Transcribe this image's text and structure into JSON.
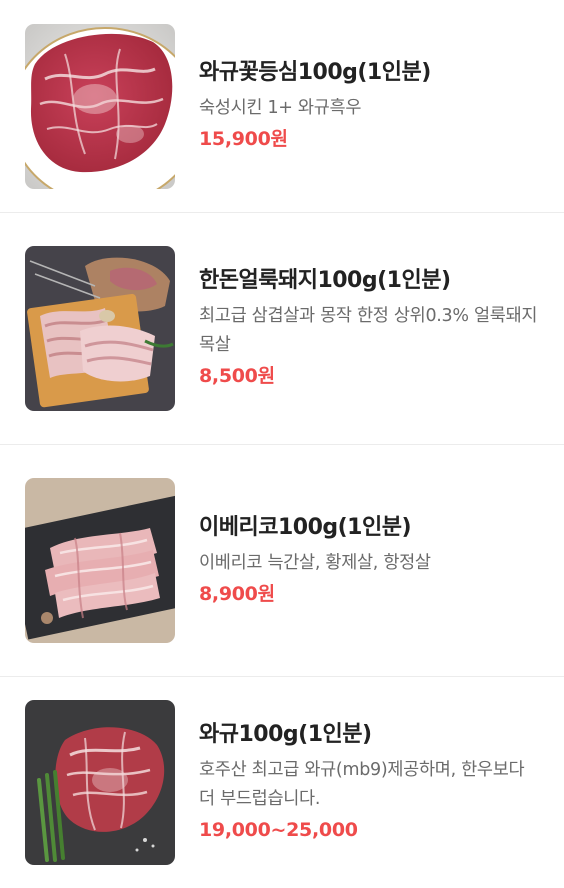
{
  "menu": {
    "items": [
      {
        "name": "와규꽃등심100g(1인분)",
        "description": "숙성시킨 1+ 와규흑우",
        "price": "15,900원",
        "image": "wagyu-ribeye-steak-photo"
      },
      {
        "name": "한돈얼룩돼지100g(1인분)",
        "description": "최고급 삼겹살과 몽작 한정 상위0.3% 얼룩돼지 목살",
        "price": "8,500원",
        "image": "pork-belly-on-board-photo"
      },
      {
        "name": "이베리코100g(1인분)",
        "description": "이베리코 늑간살, 황제살, 항정살",
        "price": "8,900원",
        "image": "iberico-pork-slices-photo"
      },
      {
        "name": "와규100g(1인분)",
        "description": "호주산 최고급 와규(mb9)제공하며, 한우보다 더 부드럽습니다.",
        "price": "19,000~25,000",
        "image": "wagyu-steak-with-asparagus-photo"
      }
    ]
  },
  "colors": {
    "price": "#ef4b4b",
    "name": "#222222",
    "description": "#6b6b6b",
    "divider": "#ececec"
  }
}
